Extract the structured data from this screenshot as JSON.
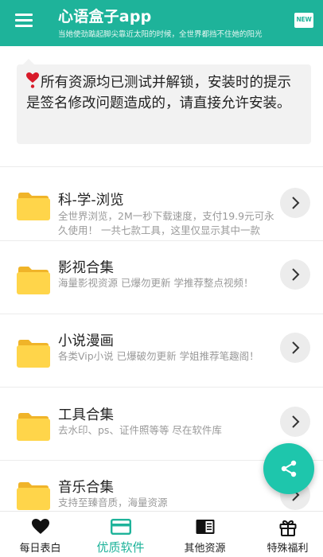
{
  "header": {
    "title": "心语盒子app",
    "subtitle": "当她使劲踮起脚尖靠近太阳的时候，全世界都挡不住她的阳光",
    "new_badge": "NEW"
  },
  "notice": {
    "text": "所有资源均已测试并解锁，安装时的提示是签名修改问题造成的，请直接允许安装。"
  },
  "list": [
    {
      "title": "科-学-浏览",
      "desc": "全世界浏览，2M一秒下载速度，支付19.9元可永久使用！ 一共七款工具，这里仅显示其中一款"
    },
    {
      "title": "影视合集",
      "desc": "海量影视资源 已爆勿更新 学推荐整点视频！"
    },
    {
      "title": "小说漫画",
      "desc": "各类Vip小说 已爆破勿更新 学姐推荐笔趣阁！"
    },
    {
      "title": "工具合集",
      "desc": "去水印、ps、证件照等等 尽在软件库"
    },
    {
      "title": "音乐合集",
      "desc": "支持至臻音质，海量资源"
    }
  ],
  "nav": [
    {
      "label": "每日表白",
      "icon": "heart-icon"
    },
    {
      "label": "优质软件",
      "icon": "card-icon",
      "active": true
    },
    {
      "label": "其他资源",
      "icon": "book-icon"
    },
    {
      "label": "特殊福利",
      "icon": "gift-icon"
    }
  ],
  "colors": {
    "accent": "#1eb39a",
    "fab": "#1ec6ac",
    "folder": "#ffcf40"
  }
}
